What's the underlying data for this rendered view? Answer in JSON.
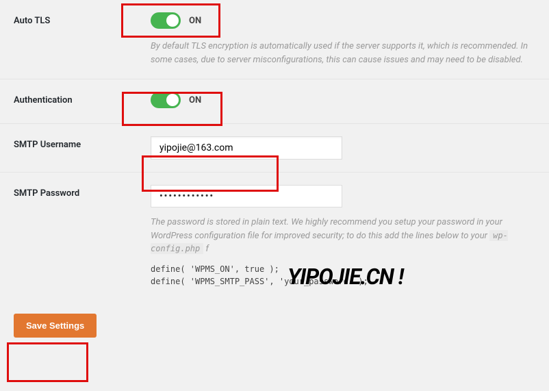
{
  "auto_tls": {
    "label": "Auto TLS",
    "state": "ON",
    "desc": "By default TLS encryption is automatically used if the server supports it, which is recommended. In some cases, due to server misconfigurations, this can cause issues and may need to be disabled."
  },
  "authentication": {
    "label": "Authentication",
    "state": "ON"
  },
  "smtp_username": {
    "label": "SMTP Username",
    "value": "yipojie@163.com"
  },
  "smtp_password": {
    "label": "SMTP Password",
    "value": "••••••••••••",
    "desc_part1": "The password is stored in plain text. We highly recommend you setup your password in your WordPress configuration file for improved security; to do this add the lines below to your ",
    "desc_code": "wp-config.php",
    "desc_part2": " f",
    "code_line1": "define( 'WPMS_ON', true );",
    "code_line2": "define( 'WPMS_SMTP_PASS', 'your_password' );"
  },
  "save_settings": {
    "label": "Save Settings"
  },
  "watermark": "YIPOJIE.CN !"
}
